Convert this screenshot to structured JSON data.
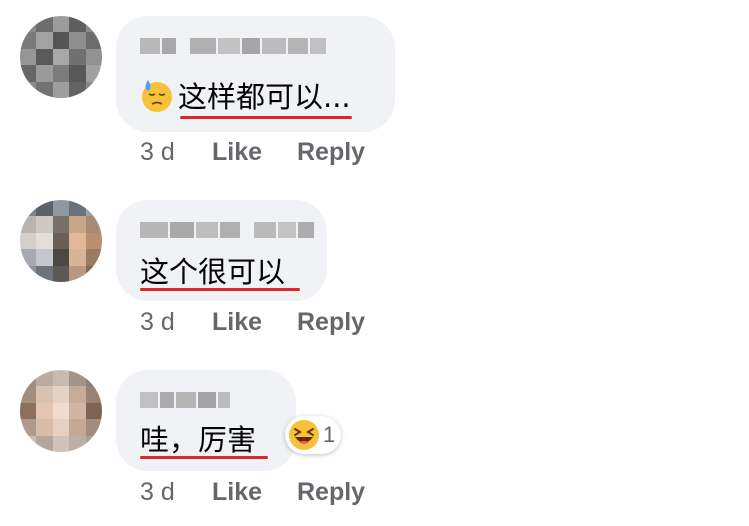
{
  "comments": [
    {
      "text": "这样都可以...",
      "time": "3 d",
      "like": "Like",
      "reply": "Reply",
      "emoji": "downcast-sweat-face-emoji"
    },
    {
      "text": "这个很可以",
      "time": "3 d",
      "like": "Like",
      "reply": "Reply"
    },
    {
      "text": "哇，厉害",
      "time": "3 d",
      "like": "Like",
      "reply": "Reply",
      "reaction": {
        "icon": "haha-reaction-icon",
        "count": "1"
      }
    }
  ],
  "colors": {
    "bubble": "#f0f2f5",
    "meta_text": "#65676b",
    "underline": "#e0242b",
    "reaction_yellow": "#f7c23a"
  }
}
